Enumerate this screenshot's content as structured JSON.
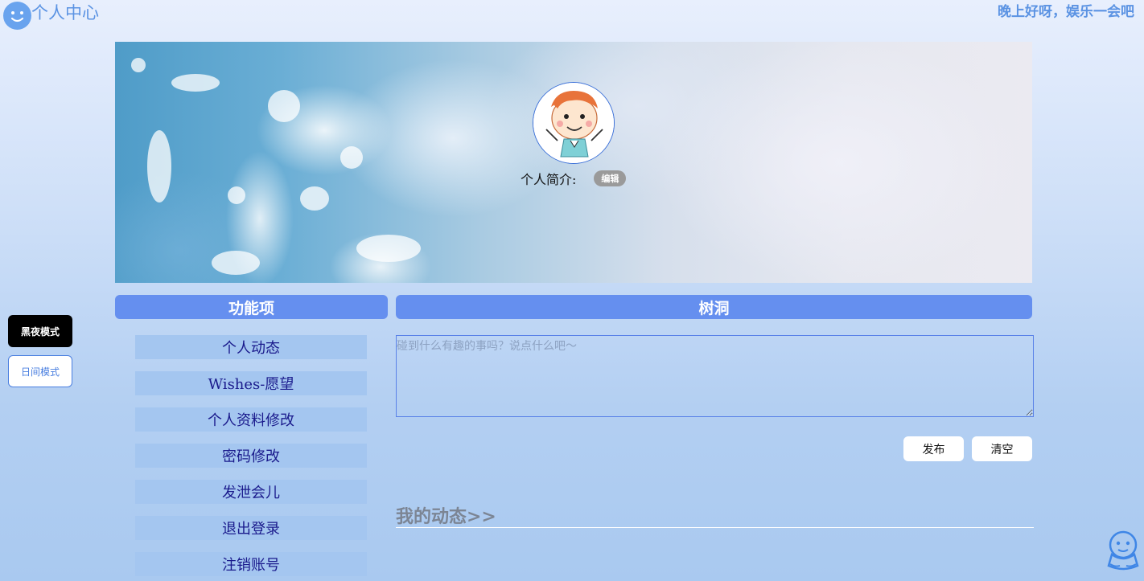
{
  "header": {
    "site_title": "个人中心",
    "greeting": "晚上好呀，娱乐一会吧",
    "logo_icon": "smiley-face-icon"
  },
  "profile": {
    "avatar_icon": "cartoon-boy-avatar",
    "intro_label": "个人简介:",
    "edit_label": "编辑"
  },
  "modes": {
    "night_label": "黑夜模式",
    "day_label": "日间模式"
  },
  "functions": {
    "title": "功能项",
    "items": [
      {
        "label": "个人动态"
      },
      {
        "label": "Wishes-愿望"
      },
      {
        "label": "个人资料修改"
      },
      {
        "label": "密码修改"
      },
      {
        "label": "发泄会儿"
      },
      {
        "label": "退出登录"
      },
      {
        "label": "注销账号"
      }
    ]
  },
  "tree_hole": {
    "title": "树洞",
    "placeholder": "碰到什么有趣的事吗？说点什么吧～",
    "publish_label": "发布",
    "clear_label": "清空"
  },
  "my_posts": {
    "title": "我的动态>>"
  },
  "colors": {
    "accent": "#658fef",
    "menu_bg": "#a4c6f0",
    "menu_text": "#1a1a8c",
    "title_blue": "#5b93e3"
  },
  "mascot_icon": "qq-penguin-icon"
}
